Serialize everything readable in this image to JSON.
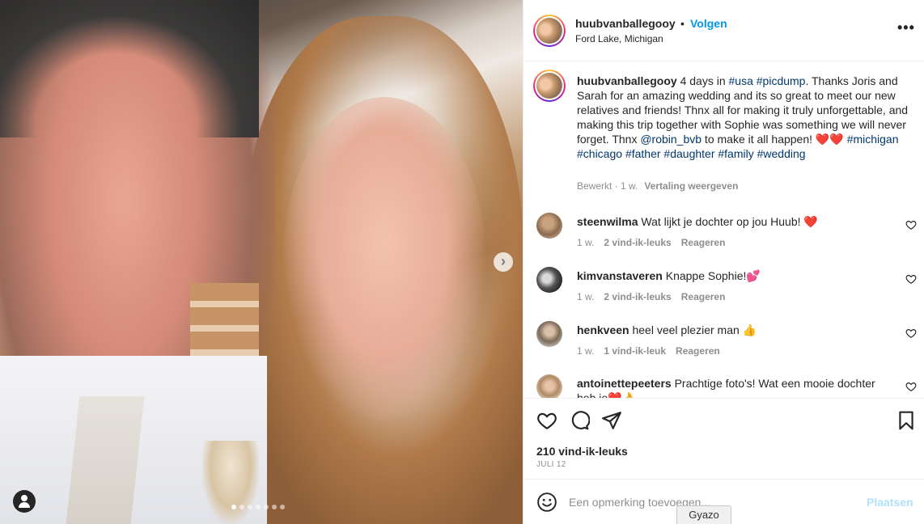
{
  "post": {
    "username": "huubvanballegooy",
    "separator": "•",
    "follow_label": "Volgen",
    "location": "Ford Lake, Michigan",
    "more_label": "•••"
  },
  "caption": {
    "username": "huubvanballegooy",
    "text_1": " 4 days in ",
    "tag_usa": "#usa",
    "space_1": " ",
    "tag_picdump": "#picdump",
    "text_2": ". Thanks Joris and Sarah for an amazing wedding and its so great to meet our new relatives and friends! Thnx all for making it truly unforgettable, and making this trip together with Sophie was something we will never forget. Thnx ",
    "mention": "@robin_bvb",
    "text_3": " to make it all happen! ",
    "hearts": "❤️❤️",
    "tag_michigan": "#michigan",
    "tag_chicago": "#chicago",
    "tag_father": "#father",
    "tag_daughter": "#daughter",
    "tag_family": "#family",
    "tag_wedding": "#wedding",
    "edited": "Bewerkt · 1 w.",
    "translate": "Vertaling weergeven"
  },
  "comments": [
    {
      "username": "steenwilma",
      "text": "Wat lijkt je dochter op jou Huub! ❤️",
      "time": "1 w.",
      "likes": "2 vind-ik-leuks",
      "reply": "Reageren"
    },
    {
      "username": "kimvanstaveren",
      "text": "Knappe Sophie!💕",
      "time": "1 w.",
      "likes": "2 vind-ik-leuks",
      "reply": "Reageren"
    },
    {
      "username": "henkveen",
      "text": "heel veel plezier man 👍",
      "time": "1 w.",
      "likes": "1 vind-ik-leuk",
      "reply": "Reageren"
    },
    {
      "username": "antoinettepeeters",
      "text": "Prachtige foto's! Wat een mooie dochter",
      "text_2": "heb je❤️👌"
    }
  ],
  "stats": {
    "likes": "210 vind-ik-leuks",
    "date": "JULI 12"
  },
  "composer": {
    "placeholder": "Een opmerking toevoegen...",
    "post_label": "Plaatsen"
  },
  "overlay": {
    "gyazo_label": "Gyazo"
  },
  "carousel": {
    "slide_count": 7,
    "active_index": 0
  }
}
